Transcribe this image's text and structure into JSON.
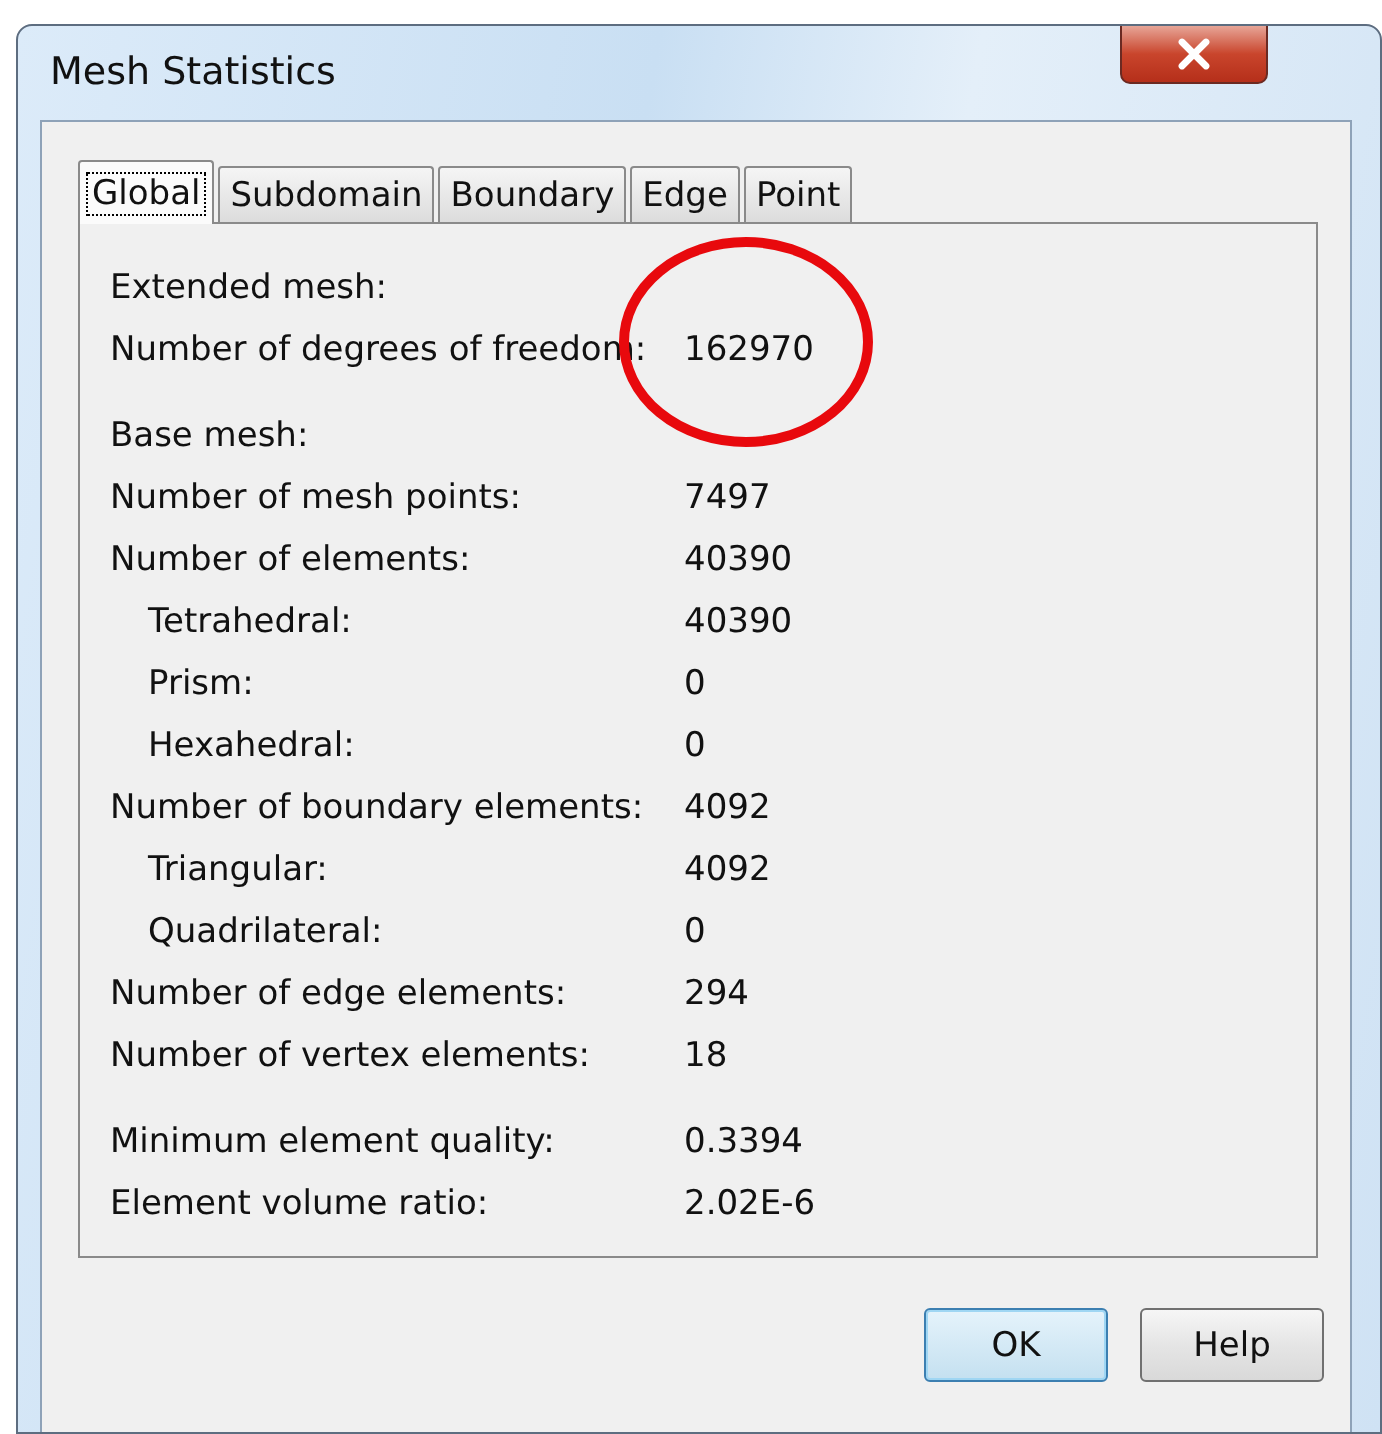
{
  "window": {
    "title": "Mesh Statistics"
  },
  "tabs": [
    {
      "label": "Global",
      "selected": true
    },
    {
      "label": "Subdomain",
      "selected": false
    },
    {
      "label": "Boundary",
      "selected": false
    },
    {
      "label": "Edge",
      "selected": false
    },
    {
      "label": "Point",
      "selected": false
    }
  ],
  "groups": [
    {
      "heading": "Extended mesh:",
      "rows": [
        {
          "label": "Number of degrees of freedom:",
          "value": "162970"
        }
      ]
    },
    {
      "heading": "Base mesh:",
      "rows": [
        {
          "label": "Number of mesh points:",
          "value": "7497"
        },
        {
          "label": "Number of elements:",
          "value": "40390",
          "children": [
            {
              "label": "Tetrahedral:",
              "value": "40390"
            },
            {
              "label": "Prism:",
              "value": "0"
            },
            {
              "label": "Hexahedral:",
              "value": "0"
            }
          ]
        },
        {
          "label": "Number of boundary elements:",
          "value": "4092",
          "children": [
            {
              "label": "Triangular:",
              "value": "4092"
            },
            {
              "label": "Quadrilateral:",
              "value": "0"
            }
          ]
        },
        {
          "label": "Number of edge elements:",
          "value": "294"
        },
        {
          "label": "Number of vertex elements:",
          "value": "18"
        }
      ]
    },
    {
      "rows": [
        {
          "label": "Minimum element quality:",
          "value": "0.3394"
        },
        {
          "label": "Element volume ratio:",
          "value": "2.02E-6"
        }
      ]
    }
  ],
  "buttons": [
    {
      "label": "OK",
      "default": true
    },
    {
      "label": "Help",
      "default": false
    }
  ]
}
